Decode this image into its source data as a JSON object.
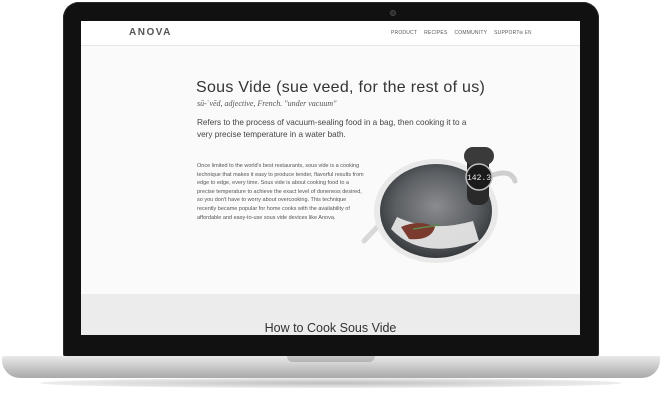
{
  "nav": {
    "logo": "ANOVA",
    "items": [
      "PRODUCT",
      "RECIPES",
      "COMMUNITY",
      "SUPPORT"
    ],
    "language": "EN"
  },
  "hero": {
    "title": "Sous Vide (sue veed, for the rest of us)",
    "pronunciation": "sū-ˈvēd, adjective, French. \"under vacuum\"",
    "lead": "Refers to the process of vacuum-sealing food in a bag, then cooking it to a very precise temperature in a water bath.",
    "body": "Once limited to the world's best restaurants, sous vide is a cooking technique that makes it easy to produce tender, flavorful results from edge to edge, every time. Sous vide is about cooking food to a precise temperature to achieve the exact level of doneness desired, so you don't have to worry about overcooking. This technique recently became popular for home cooks with the availability of affordable and easy-to-use sous vide devices like Anova."
  },
  "device": {
    "display_value": "142.3"
  },
  "section": {
    "heading": "How to Cook Sous Vide"
  }
}
